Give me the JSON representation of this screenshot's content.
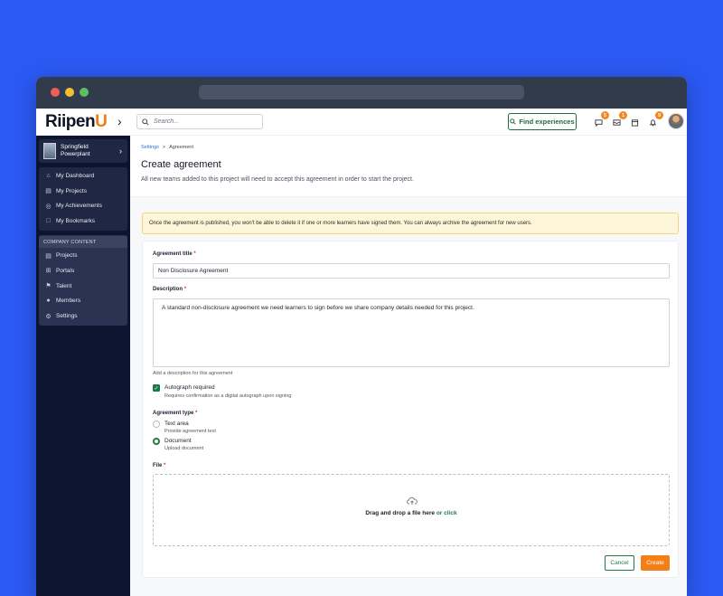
{
  "app": {
    "logo_main": "RiipenU",
    "logo_prefix": "Riipen",
    "logo_suffix": "U",
    "search_placeholder": "Search...",
    "find_label": "Find experiences",
    "badges": {
      "messages": "5",
      "inbox": "1",
      "notifications": "9"
    },
    "accent": "#f57f17",
    "brand_green": "#1d7a45"
  },
  "sidebar": {
    "org_name_1": "Springfield",
    "org_name_2": "Powerplant",
    "personal": [
      {
        "label": "My Dashboard",
        "icon": "home-icon"
      },
      {
        "label": "My Projects",
        "icon": "folder-icon"
      },
      {
        "label": "My Achievements",
        "icon": "badge-icon"
      },
      {
        "label": "My Bookmarks",
        "icon": "bookmark-icon"
      }
    ],
    "company_heading": "COMPANY CONTENT",
    "company": [
      {
        "label": "Projects",
        "icon": "folder-icon"
      },
      {
        "label": "Portals",
        "icon": "portal-icon"
      },
      {
        "label": "Talent",
        "icon": "talent-icon"
      },
      {
        "label": "Members",
        "icon": "members-icon"
      },
      {
        "label": "Settings",
        "icon": "gear-icon"
      }
    ]
  },
  "page": {
    "breadcrumb": {
      "parent": "Settings",
      "sep": ">",
      "current": "Agreement"
    },
    "title": "Create agreement",
    "subtitle": "All new teams added to this project will need to accept this agreement in order to start the project.",
    "warning": "Once the agreement is published, you won't be able to delete it if one or more learners have signed them. You can always archive the agreement for new users."
  },
  "form": {
    "title_label": "Agreement title",
    "title_value": "Non Disclosure Agreement",
    "desc_label": "Description",
    "desc_value": "A standard non-disclosure agreement we need learners to sign before we share company details needed for this project.",
    "desc_helper": "Add a description for this agreement",
    "autograph_label": "Autograph required",
    "autograph_sub": "Requires confirmation as a digital autograph upon signing",
    "autograph_checked": true,
    "type_label": "Agreement type",
    "type_options": [
      {
        "label": "Text area",
        "sub": "Provide agreement text",
        "selected": false
      },
      {
        "label": "Document",
        "sub": "Upload document",
        "selected": true
      }
    ],
    "file_label": "File",
    "drop_text": "Drag and drop a file here",
    "drop_link": "or click",
    "required_mark": "*",
    "cancel_label": "Cancel",
    "create_label": "Create"
  }
}
